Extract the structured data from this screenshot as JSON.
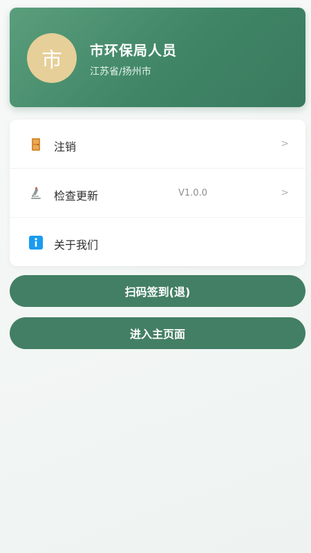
{
  "profile": {
    "avatar_char": "市",
    "name": "市环保局人员",
    "location": "江苏省/扬州市"
  },
  "menu": {
    "items": [
      {
        "label": "注销",
        "value": "",
        "arrow": ">",
        "icon": "door-icon"
      },
      {
        "label": "检查更新",
        "value": "V1.0.0",
        "arrow": ">",
        "icon": "microscope-icon"
      },
      {
        "label": "关于我们",
        "value": "",
        "arrow": "",
        "icon": "info-icon"
      }
    ]
  },
  "buttons": {
    "scan_label": "扫码签到(退)",
    "enter_label": "进入主页面"
  },
  "colors": {
    "primary": "#437f64",
    "avatar_bg": "#e6cf98",
    "info_icon": "#1a9bf0",
    "door_icon": "#d68a2e"
  }
}
